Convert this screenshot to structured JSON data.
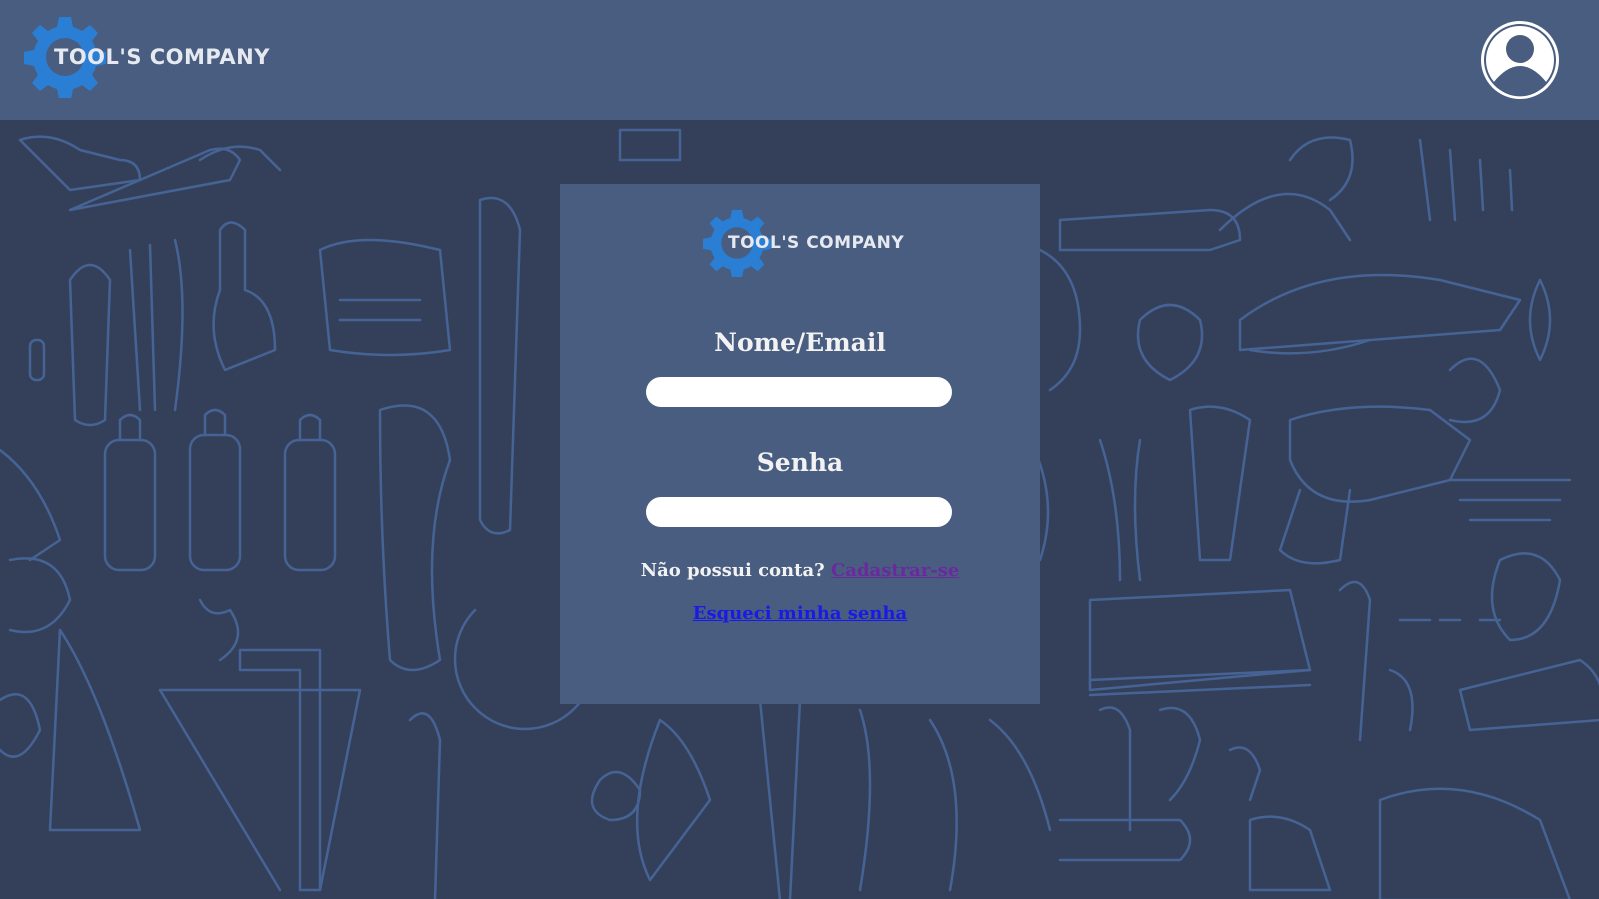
{
  "header": {
    "logo_text": "TOOL'S COMPANY",
    "avatar_icon": "user-circle-icon"
  },
  "login": {
    "logo_text": "TOOL'S COMPANY",
    "name_label": "Nome/Email",
    "name_value": "",
    "password_label": "Senha",
    "password_value": "",
    "no_account_text": "Não possui conta?",
    "signup_link": "Cadastrar-se",
    "forgot_link": "Esqueci minha senha"
  },
  "colors": {
    "header_bg": "#485d80",
    "page_bg": "#344059",
    "card_bg": "#485d80",
    "gear_blue": "#2a7fd4",
    "signup_link": "#6a2a9e",
    "forgot_link": "#1a1ae6"
  },
  "background": {
    "pattern": "tools-doodle-pattern"
  }
}
